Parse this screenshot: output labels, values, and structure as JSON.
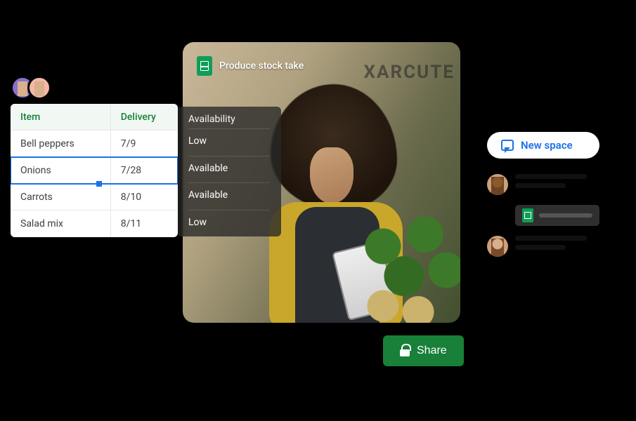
{
  "document": {
    "title": "Produce stock take"
  },
  "spreadsheet": {
    "headers": {
      "item": "Item",
      "delivery": "Delivery"
    },
    "rows": [
      {
        "item": "Bell peppers",
        "delivery": "7/9",
        "selected": false
      },
      {
        "item": "Onions",
        "delivery": "7/28",
        "selected": true
      },
      {
        "item": "Carrots",
        "delivery": "8/10",
        "selected": false
      },
      {
        "item": "Salad mix",
        "delivery": "8/11",
        "selected": false
      }
    ]
  },
  "availability": {
    "header": "Availability",
    "values": [
      "Low",
      "Available",
      "Available",
      "Low"
    ]
  },
  "share": {
    "label": "Share"
  },
  "chat": {
    "new_space_label": "New space"
  },
  "background_sign": "XARCUTE",
  "colors": {
    "sheets_green": "#188038",
    "google_blue": "#1a73e8"
  }
}
